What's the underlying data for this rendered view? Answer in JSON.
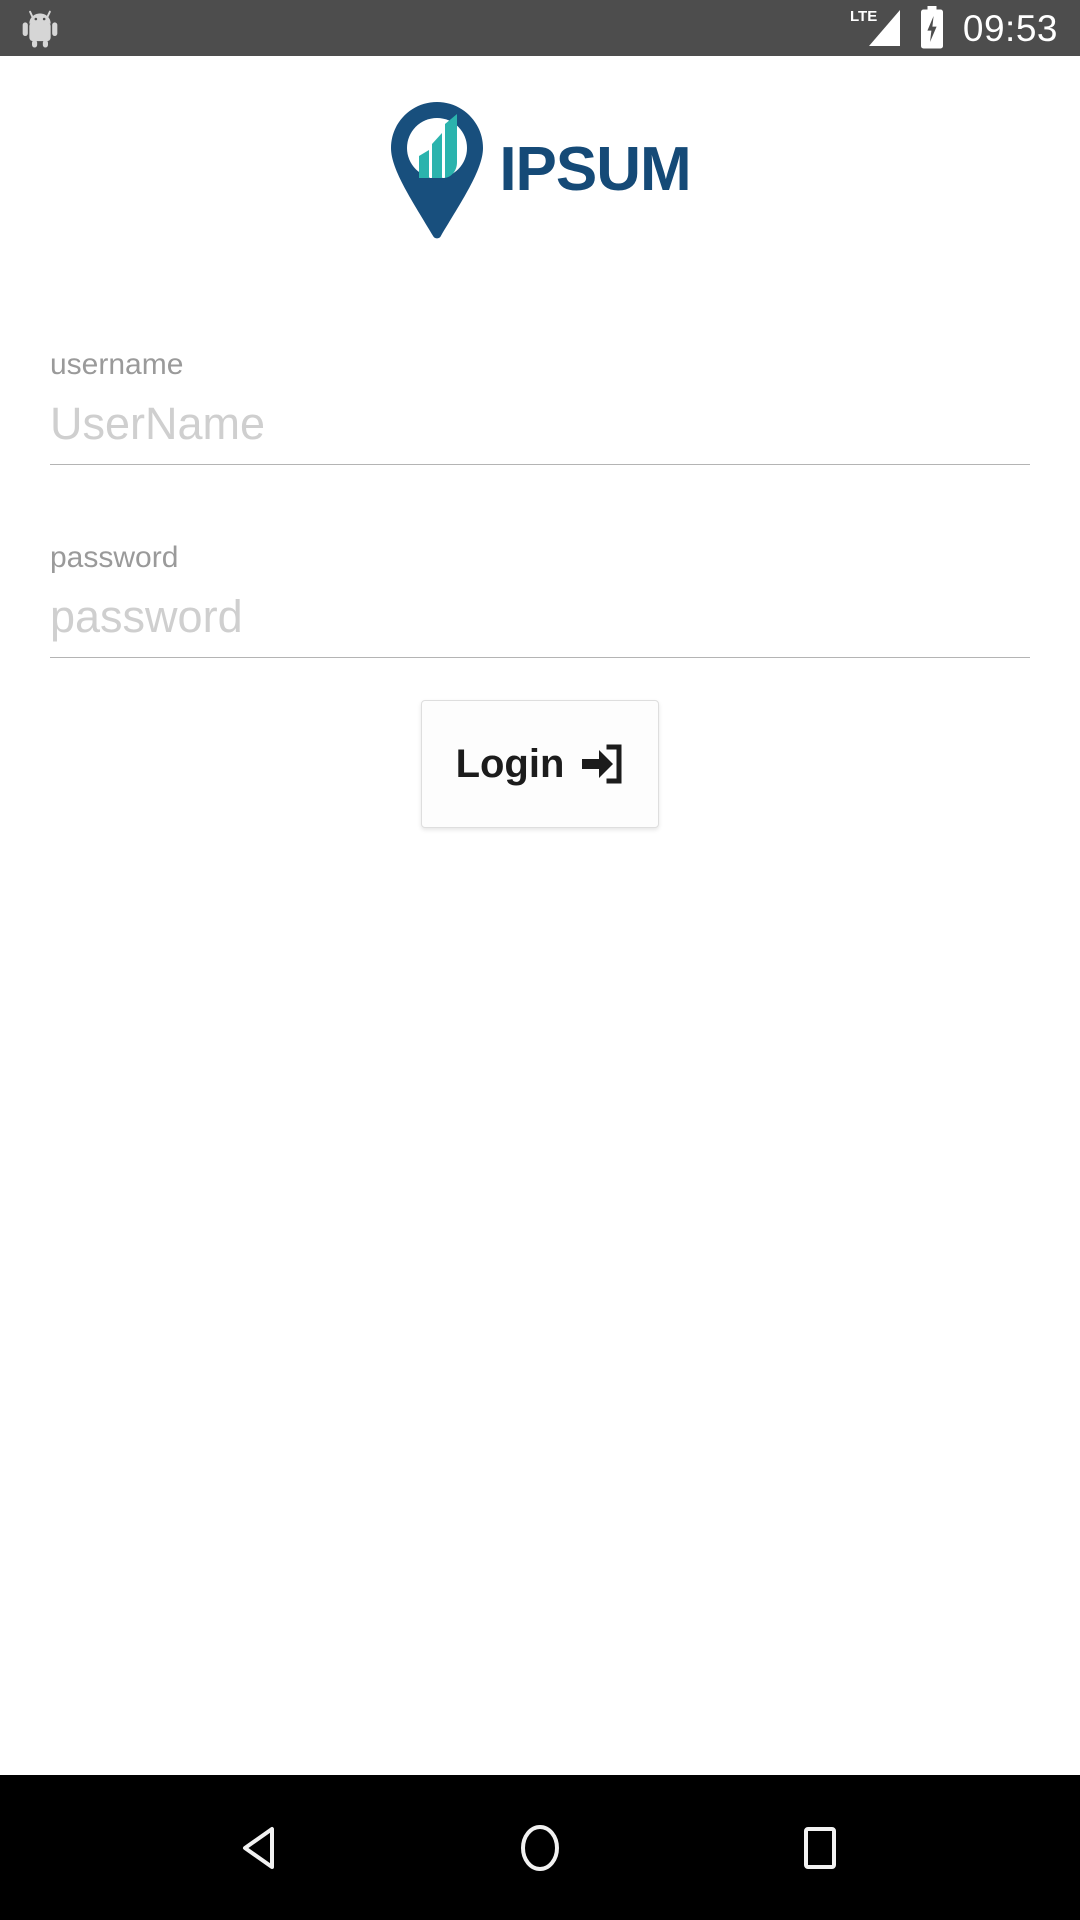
{
  "status_bar": {
    "notification_icon": "android-robot-icon",
    "network_label": "LTE",
    "signal_icon": "signal-bars-icon",
    "battery_icon": "battery-charging-icon",
    "clock": "09:53",
    "background_color": "#4d4d4d",
    "foreground_color": "#ffffff"
  },
  "brand": {
    "mark_icon": "location-pin-bar-chart-logo",
    "name": "IPSUM",
    "primary_color": "#154a77",
    "accent_color": "#23a5a5"
  },
  "form": {
    "username": {
      "label": "username",
      "placeholder": "UserName",
      "value": ""
    },
    "password": {
      "label": "password",
      "placeholder": "password",
      "value": ""
    },
    "submit": {
      "label": "Login",
      "icon": "sign-in-alt-icon"
    }
  },
  "nav_bar": {
    "back": "back-triangle-icon",
    "home": "home-circle-icon",
    "recents": "recents-square-icon",
    "background_color": "#000000"
  }
}
